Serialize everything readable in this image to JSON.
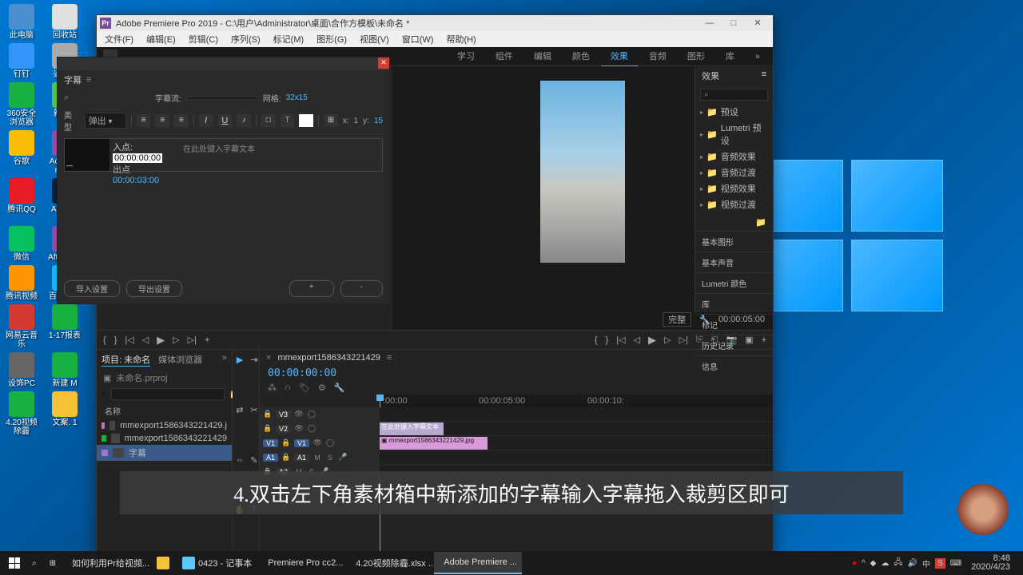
{
  "desktop": {
    "icons": [
      {
        "label": "此电脑",
        "color": "#4a90d0"
      },
      {
        "label": "回收站",
        "color": "#e0e0e0"
      },
      {
        "label": "钉钉",
        "color": "#3296fa"
      },
      {
        "label": "通道...",
        "color": "#aaa"
      },
      {
        "label": "360安全浏览器",
        "color": "#18b040"
      },
      {
        "label": "新建...",
        "color": "#5ac040"
      },
      {
        "label": "谷歌",
        "color": "#fbbc05"
      },
      {
        "label": "Ac... Premie...",
        "color": "#9a4a9e"
      },
      {
        "label": "腾讯QQ",
        "color": "#ea1b26"
      },
      {
        "label": "Ac photo...",
        "color": "#001d34"
      },
      {
        "label": "微信",
        "color": "#07c160"
      },
      {
        "label": "After Ef...",
        "color": "#9a4a9e"
      },
      {
        "label": "腾讯视频",
        "color": "#ff9500"
      },
      {
        "label": "百度网盘",
        "color": "#13b7f5"
      },
      {
        "label": "网易云音乐",
        "color": "#d33a31"
      },
      {
        "label": "1-17报表",
        "color": "#18b040"
      },
      {
        "label": "设饰PC",
        "color": "#666"
      },
      {
        "label": "新建 M",
        "color": "#18b040"
      },
      {
        "label": "4.20视频除霾",
        "color": "#18b040"
      },
      {
        "label": "文案. 1",
        "color": "#f5c237"
      }
    ]
  },
  "premiere": {
    "title": "Adobe Premiere Pro 2019 - C:\\用户\\Administrator\\桌面\\合作方模板\\未命名 *",
    "menu": [
      "文件(F)",
      "编辑(E)",
      "剪辑(C)",
      "序列(S)",
      "标记(M)",
      "图形(G)",
      "视图(V)",
      "窗口(W)",
      "帮助(H)"
    ],
    "workspace": {
      "tabs": [
        "学习",
        "组件",
        "编辑",
        "颜色",
        "效果",
        "音频",
        "图形",
        "库"
      ],
      "active": "效果"
    },
    "subtitle_panel": {
      "title": "字幕",
      "stream_label": "字幕流:",
      "grid_label": "网格:",
      "grid_value": "32x15",
      "font_label": "类型",
      "font_value": "弹出",
      "x_label": "x:",
      "x_value": "1",
      "y_label": "y:",
      "y_value": "15",
      "in_label": "入点:",
      "in_value": "00:00:00:00",
      "out_label": "出点",
      "out_value": "00:00:03:00",
      "placeholder": "在此处键入字幕文本",
      "import": "导入设置",
      "export": "导出设置",
      "plus": "+",
      "minus": "-"
    },
    "preview": {
      "quality": "完整",
      "timecode": "00:00:05:00"
    },
    "project": {
      "tabs": [
        "项目: 未命名",
        "媒体浏览器"
      ],
      "filename": "未命名.prproj",
      "header": "名称",
      "items": [
        {
          "name": "mmexport1586343221429.j",
          "color": "#c070c0"
        },
        {
          "name": "mmexport1586343221429",
          "color": "#18b040"
        },
        {
          "name": "字幕",
          "color": "#9a7aca",
          "selected": true
        }
      ]
    },
    "timeline": {
      "sequence": "mmexport1586343221429",
      "timecode": "00:00:00:00",
      "ruler": [
        ":00:00",
        "00:00:05:00",
        "00:00:10:"
      ],
      "tracks_v": [
        "V3",
        "V2",
        "V1"
      ],
      "tracks_a": [
        "A1",
        "A2"
      ],
      "clip_sub": "在此处键入字幕文本",
      "clip_vid": "mmexport1586343221429.jpg"
    },
    "effects": {
      "title": "效果",
      "folders": [
        "预设",
        "Lumetri 预设",
        "音频效果",
        "音频过渡",
        "视频效果",
        "视频过渡"
      ],
      "panels": [
        "基本图形",
        "基本声音",
        "Lumetri 颜色",
        "库",
        "标记",
        "历史记录",
        "信息"
      ]
    }
  },
  "instruction": "4.双击左下角素材箱中新添加的字幕输入字幕拖入裁剪区即可",
  "taskbar": {
    "tasks": [
      {
        "label": "如何利用Pr给视频...",
        "color": "#18b040"
      },
      {
        "label": "",
        "color": "#f5c237",
        "icon_only": true
      },
      {
        "label": "0423 - 记事本",
        "color": "#5ac8fa"
      },
      {
        "label": "Premiere Pro cc2...",
        "color": "#fbbc05"
      },
      {
        "label": "4.20视频除霾.xlsx ...",
        "color": "#18b040"
      },
      {
        "label": "Adobe Premiere ...",
        "color": "#9a4a9e",
        "active": true
      }
    ],
    "clock": {
      "time": "8:48",
      "date": "2020/4/23"
    }
  }
}
